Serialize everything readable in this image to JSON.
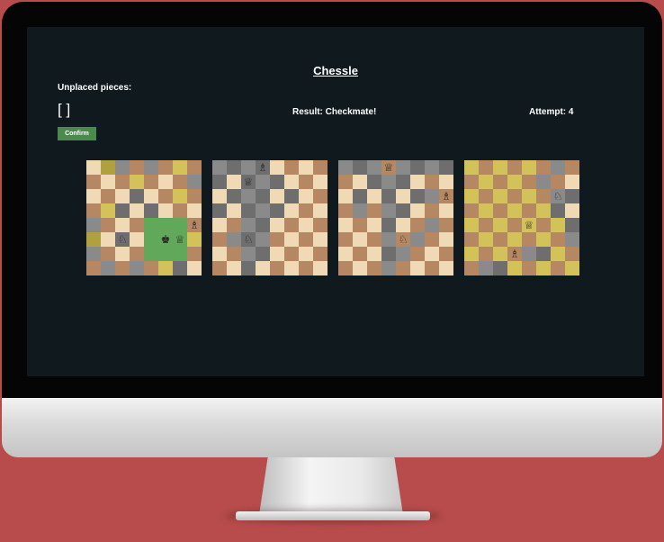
{
  "app": {
    "title": "Chessle",
    "unplaced_label": "Unplaced pieces:",
    "unplaced_value": "[ ]",
    "result": "Result: Checkmate!",
    "attempt": "Attempt: 4",
    "confirm_label": "Confirm"
  },
  "colors": {
    "light": "#f0d9b5",
    "dark": "#b58863",
    "gray_light": "#8a8a8a",
    "gray_dark": "#6e6e6e",
    "olive_light": "#d3c25a",
    "olive_dark": "#b0a03e",
    "green": "#62a85a",
    "screen_bg": "#0f191e"
  },
  "boards": [
    {
      "gray": [
        [
          0,
          2
        ],
        [
          0,
          4
        ],
        [
          1,
          7
        ],
        [
          2,
          3
        ],
        [
          3,
          2
        ],
        [
          3,
          4
        ],
        [
          4,
          0
        ],
        [
          5,
          2
        ],
        [
          6,
          0
        ],
        [
          6,
          4
        ],
        [
          7,
          1
        ],
        [
          7,
          3
        ],
        [
          7,
          6
        ]
      ],
      "olive": [
        [
          0,
          1
        ],
        [
          0,
          6
        ],
        [
          1,
          3
        ],
        [
          2,
          6
        ],
        [
          3,
          1
        ],
        [
          4,
          5
        ],
        [
          5,
          0
        ],
        [
          5,
          7
        ],
        [
          6,
          6
        ],
        [
          7,
          5
        ]
      ],
      "green": [
        [
          4,
          4
        ],
        [
          4,
          5
        ],
        [
          4,
          6
        ],
        [
          5,
          4
        ],
        [
          5,
          5
        ],
        [
          5,
          6
        ],
        [
          6,
          4
        ],
        [
          6,
          5
        ],
        [
          6,
          6
        ]
      ],
      "pieces": [
        {
          "r": 4,
          "c": 7,
          "glyph": "♗",
          "name": "bishop-icon"
        },
        {
          "r": 5,
          "c": 2,
          "glyph": "♘",
          "name": "knight-icon"
        },
        {
          "r": 5,
          "c": 5,
          "glyph": "♚",
          "name": "black-king-icon"
        },
        {
          "r": 5,
          "c": 6,
          "glyph": "♕",
          "name": "queen-icon"
        }
      ]
    },
    {
      "gray": [
        [
          0,
          0
        ],
        [
          0,
          1
        ],
        [
          0,
          2
        ],
        [
          0,
          3
        ],
        [
          1,
          0
        ],
        [
          1,
          2
        ],
        [
          1,
          3
        ],
        [
          1,
          4
        ],
        [
          2,
          1
        ],
        [
          2,
          2
        ],
        [
          2,
          3
        ],
        [
          2,
          5
        ],
        [
          3,
          0
        ],
        [
          3,
          2
        ],
        [
          3,
          3
        ],
        [
          3,
          4
        ],
        [
          4,
          2
        ],
        [
          4,
          3
        ],
        [
          5,
          1
        ],
        [
          5,
          2
        ],
        [
          5,
          3
        ],
        [
          6,
          2
        ],
        [
          6,
          3
        ],
        [
          7,
          2
        ]
      ],
      "olive": [],
      "green": [],
      "pieces": [
        {
          "r": 0,
          "c": 3,
          "glyph": "♗",
          "name": "bishop-icon"
        },
        {
          "r": 1,
          "c": 2,
          "glyph": "♕",
          "name": "queen-icon"
        },
        {
          "r": 5,
          "c": 2,
          "glyph": "♘",
          "name": "knight-icon"
        }
      ]
    },
    {
      "gray": [
        [
          0,
          0
        ],
        [
          0,
          1
        ],
        [
          0,
          2
        ],
        [
          0,
          4
        ],
        [
          0,
          5
        ],
        [
          0,
          6
        ],
        [
          0,
          7
        ],
        [
          1,
          2
        ],
        [
          1,
          3
        ],
        [
          1,
          4
        ],
        [
          2,
          1
        ],
        [
          2,
          3
        ],
        [
          2,
          5
        ],
        [
          2,
          6
        ],
        [
          3,
          1
        ],
        [
          3,
          3
        ],
        [
          3,
          4
        ],
        [
          4,
          3
        ],
        [
          4,
          6
        ],
        [
          5,
          3
        ],
        [
          5,
          5
        ],
        [
          6,
          3
        ],
        [
          6,
          4
        ],
        [
          7,
          3
        ]
      ],
      "olive": [],
      "green": [],
      "pieces": [
        {
          "r": 0,
          "c": 3,
          "glyph": "♕",
          "name": "queen-icon"
        },
        {
          "r": 2,
          "c": 7,
          "glyph": "♗",
          "name": "bishop-icon"
        },
        {
          "r": 5,
          "c": 4,
          "glyph": "♘",
          "name": "knight-icon"
        }
      ]
    },
    {
      "gray": [
        [
          0,
          6
        ],
        [
          1,
          5
        ],
        [
          2,
          6
        ],
        [
          2,
          7
        ],
        [
          3,
          6
        ],
        [
          4,
          7
        ],
        [
          5,
          7
        ],
        [
          6,
          4
        ],
        [
          6,
          5
        ],
        [
          7,
          1
        ],
        [
          7,
          2
        ]
      ],
      "olive": [
        [
          0,
          0
        ],
        [
          0,
          2
        ],
        [
          0,
          4
        ],
        [
          1,
          1
        ],
        [
          1,
          3
        ],
        [
          2,
          0
        ],
        [
          2,
          2
        ],
        [
          2,
          4
        ],
        [
          3,
          1
        ],
        [
          3,
          3
        ],
        [
          3,
          5
        ],
        [
          4,
          0
        ],
        [
          4,
          2
        ],
        [
          4,
          4
        ],
        [
          4,
          6
        ],
        [
          5,
          1
        ],
        [
          5,
          3
        ],
        [
          5,
          5
        ],
        [
          6,
          0
        ],
        [
          6,
          2
        ],
        [
          6,
          6
        ],
        [
          7,
          3
        ],
        [
          7,
          5
        ],
        [
          7,
          7
        ]
      ],
      "green": [],
      "pieces": [
        {
          "r": 2,
          "c": 6,
          "glyph": "♘",
          "name": "knight-icon"
        },
        {
          "r": 4,
          "c": 4,
          "glyph": "♕",
          "name": "queen-icon"
        },
        {
          "r": 6,
          "c": 3,
          "glyph": "♗",
          "name": "bishop-icon"
        }
      ]
    }
  ]
}
